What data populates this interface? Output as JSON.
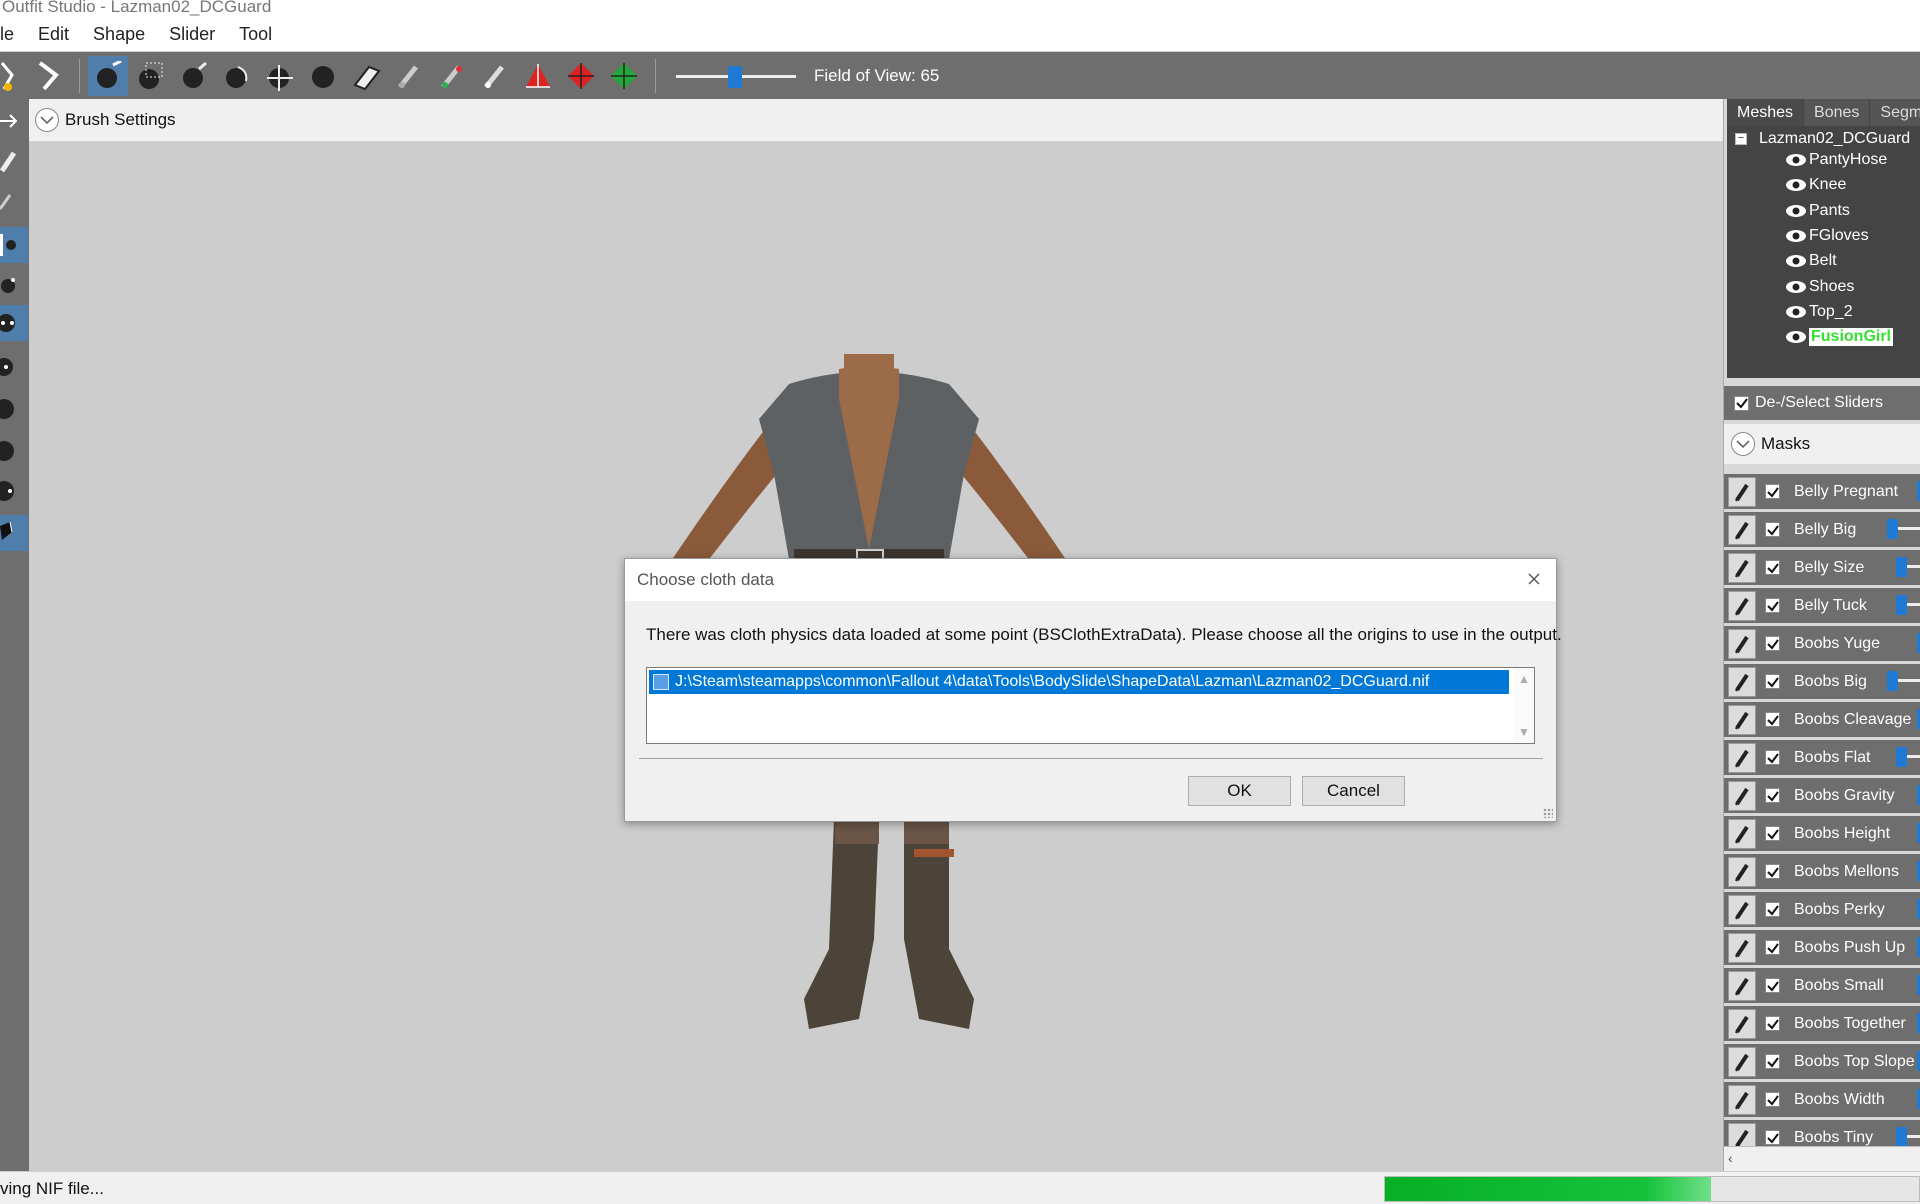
{
  "window": {
    "title": "Outfit Studio - Lazman02_DCGuard"
  },
  "menu": [
    "ile",
    "Edit",
    "Shape",
    "Slider",
    "Tool"
  ],
  "toolbar": {
    "fov_label": "Field of View: 65",
    "fov_value": 65,
    "tools": [
      "select-tool-icon",
      "transform-tool-icon",
      "mask-brush-icon",
      "select-region-icon",
      "inflate-brush-icon",
      "deflate-brush-icon",
      "move-brush-icon",
      "smooth-brush-icon",
      "undiff-brush-icon",
      "weight-brush-icon",
      "color-brush-icon",
      "alpha-brush-icon",
      "vertex-marker-icon",
      "vertex-marker-red-icon",
      "vertex-marker-green-icon"
    ]
  },
  "brush_settings": {
    "label": "Brush Settings"
  },
  "dialog": {
    "title": "Choose cloth data",
    "message": "There was cloth physics data loaded at some point (BSClothExtraData). Please choose all the origins to use in the output.",
    "items": [
      "J:\\Steam\\steamapps\\common\\Fallout 4\\data\\Tools\\BodySlide\\ShapeData\\Lazman\\Lazman02_DCGuard.nif"
    ],
    "ok": "OK",
    "cancel": "Cancel"
  },
  "right_panel": {
    "tabs": [
      "Meshes",
      "Bones",
      "Segme"
    ],
    "tree_root": "Lazman02_DCGuard",
    "meshes": [
      "PantyHose",
      "Knee",
      "Pants",
      "FGloves",
      "Belt",
      "Shoes",
      "Top_2",
      "FusionGirl"
    ],
    "selected_mesh": "FusionGirl",
    "deselect_label": "De-/Select Sliders",
    "masks_label": "Masks",
    "sliders": [
      {
        "name": "Belly Pregnant",
        "level": null
      },
      {
        "name": "Belly Big",
        "level": 0.02
      },
      {
        "name": "Belly Size",
        "level": 0.02
      },
      {
        "name": "Belly Tuck",
        "level": 0.02
      },
      {
        "name": "Boobs Yuge",
        "level": null
      },
      {
        "name": "Boobs Big",
        "level": 0.02
      },
      {
        "name": "Boobs Cleavage",
        "level": null
      },
      {
        "name": "Boobs Flat",
        "level": 0.02
      },
      {
        "name": "Boobs Gravity",
        "level": null
      },
      {
        "name": "Boobs Height",
        "level": null
      },
      {
        "name": "Boobs Mellons",
        "level": null
      },
      {
        "name": "Boobs Perky",
        "level": null
      },
      {
        "name": "Boobs Push Up",
        "level": null
      },
      {
        "name": "Boobs Small",
        "level": null
      },
      {
        "name": "Boobs Together",
        "level": null
      },
      {
        "name": "Boobs Top Slope",
        "level": null
      },
      {
        "name": "Boobs Width",
        "level": null
      },
      {
        "name": "Boobs Tiny",
        "level": 0.02
      }
    ]
  },
  "status": {
    "text": "ving NIF file...",
    "progress": 0.61
  },
  "colors": {
    "accent": "#0078d7",
    "progress": "#06b025",
    "selected_mesh": "#35e12f"
  }
}
